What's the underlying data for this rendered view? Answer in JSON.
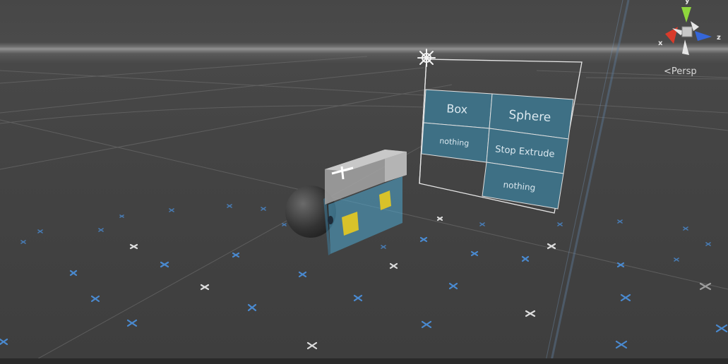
{
  "viewport": {
    "projection_label": "Persp",
    "axes": {
      "x": "x",
      "y": "y",
      "z": "z"
    }
  },
  "menu_panel": {
    "buttons": {
      "box": "Box",
      "sphere": "Sphere",
      "nothing_left": "nothing",
      "stop_extrude": "Stop Extrude",
      "nothing_bottom": "nothing"
    }
  },
  "colors": {
    "background": "#3e3e3e",
    "button_fill": "#3e7085",
    "axis_x": "#d93b2b",
    "axis_y": "#8ed63c",
    "axis_z": "#3566d9",
    "grid_marker_blue": "#4a8ad0",
    "grid_marker_white": "#dcdcdc"
  }
}
